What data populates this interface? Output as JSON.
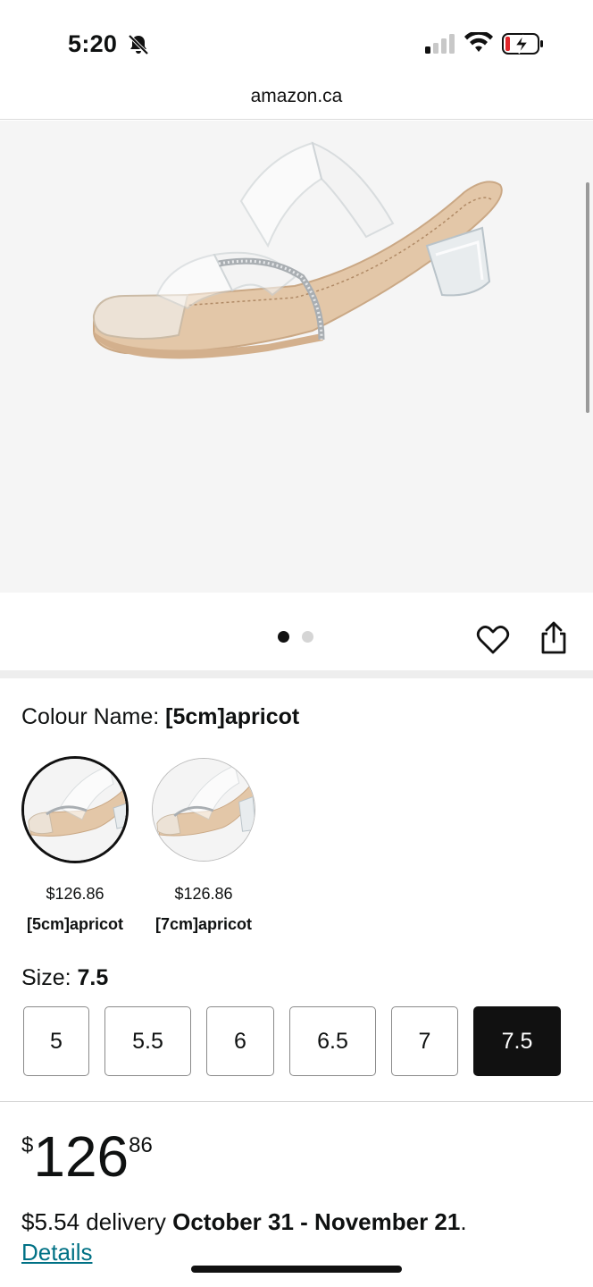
{
  "status_bar": {
    "time": "5:20"
  },
  "browser": {
    "url": "amazon.ca"
  },
  "gallery": {
    "page_count": 2,
    "active_page": 1
  },
  "variant": {
    "colour_label": "Colour Name: ",
    "colour_value": "[5cm]apricot",
    "options": [
      {
        "price": "$126.86",
        "name": "[5cm]apricot",
        "selected": true
      },
      {
        "price": "$126.86",
        "name": "[7cm]apricot",
        "selected": false
      }
    ]
  },
  "size": {
    "label": "Size: ",
    "value": "7.5",
    "options": [
      "5",
      "5.5",
      "6",
      "6.5",
      "7",
      "7.5"
    ],
    "selected": "7.5"
  },
  "price": {
    "symbol": "$",
    "whole": "126",
    "fraction": "86"
  },
  "delivery": {
    "prefix": "$5.54 delivery ",
    "dates": "October 31 - November 21",
    "suffix": ".",
    "details_link": "Details"
  },
  "colors": {
    "accent_link": "#007185",
    "selected_size_bg": "#111111"
  },
  "icons": [
    "silent-bell-icon",
    "signal-icon",
    "wifi-icon",
    "battery-charging-icon",
    "heart-icon",
    "share-icon"
  ]
}
